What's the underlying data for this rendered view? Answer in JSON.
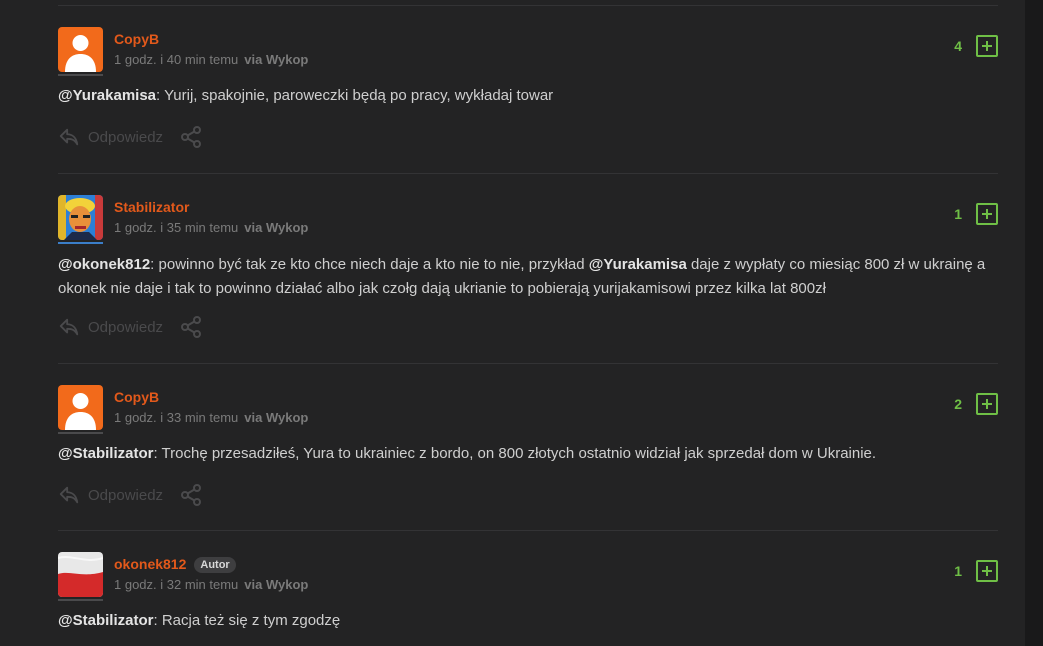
{
  "reply_label": "Odpowiedz",
  "colors": {
    "author": "#e2591b",
    "vote": "#6fbf46",
    "background": "#232324"
  },
  "comments": [
    {
      "author": "CopyB",
      "time": "1 godz. i 40 min temu",
      "via": "via Wykop",
      "votes": "4",
      "avatar": "default-orange-avatar",
      "mention": "@Yurakamisa",
      "text": ": Yurij, spakojnie, paroweczki będą po pracy, wykładaj towar"
    },
    {
      "author": "Stabilizator",
      "time": "1 godz. i 35 min temu",
      "via": "via Wykop",
      "votes": "1",
      "avatar": "portrait-avatar",
      "mention": "@okonek812",
      "text": ": powinno być tak ze kto chce niech daje a kto nie to nie, przykład ",
      "mention2": "@Yurakamisa",
      "text2": " daje z wypłaty co miesiąc 800 zł w ukrainę a okonek nie daje i tak to powinno działać albo jak czołg dają ukrianie to pobierają yurijakamisowi przez kilka lat 800zł"
    },
    {
      "author": "CopyB",
      "time": "1 godz. i 33 min temu",
      "via": "via Wykop",
      "votes": "2",
      "avatar": "default-orange-avatar",
      "mention": "@Stabilizator",
      "text": ": Trochę przesadziłeś, Yura to ukrainiec z bordo, on 800 złotych ostatnio widział jak sprzedał dom w Ukrainie."
    },
    {
      "author": "okonek812",
      "badge": "Autor",
      "time": "1 godz. i 32 min temu",
      "via": "via Wykop",
      "votes": "1",
      "avatar": "polish-flag-avatar",
      "mention": "@Stabilizator",
      "text": ": Racja też się z tym zgodzę"
    }
  ]
}
